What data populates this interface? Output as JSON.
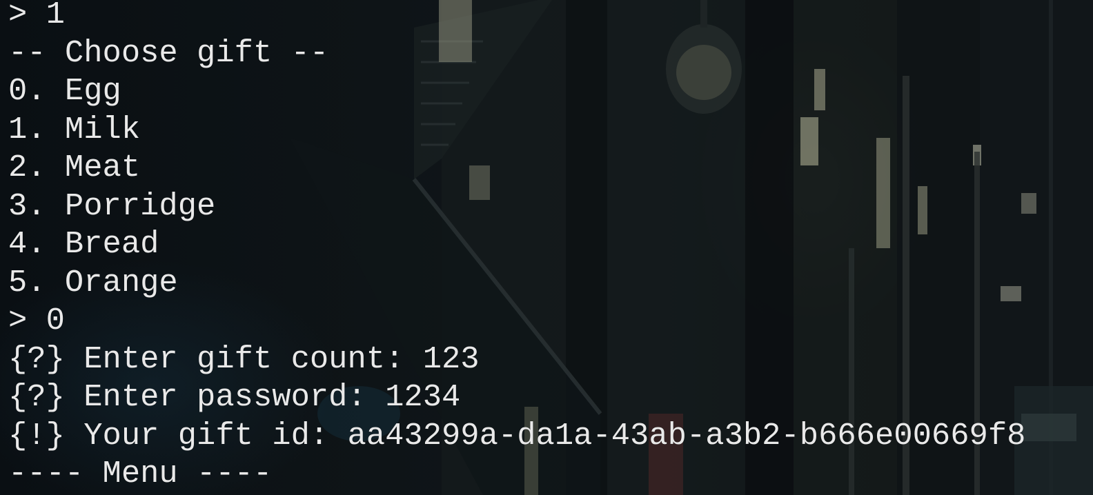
{
  "terminal": {
    "background_color": "#0b0f12",
    "text_color": "#e9e9e9",
    "lines": [
      "> 1",
      "-- Choose gift --",
      "0. Egg",
      "1. Milk",
      "2. Meat",
      "3. Porridge",
      "4. Bread",
      "5. Orange",
      "> 0",
      "{?} Enter gift count: 123",
      "{?} Enter password: 1234",
      "{!} Your gift id: aa43299a-da1a-43ab-a3b2-b666e00669f8",
      "---- Menu ----"
    ]
  }
}
